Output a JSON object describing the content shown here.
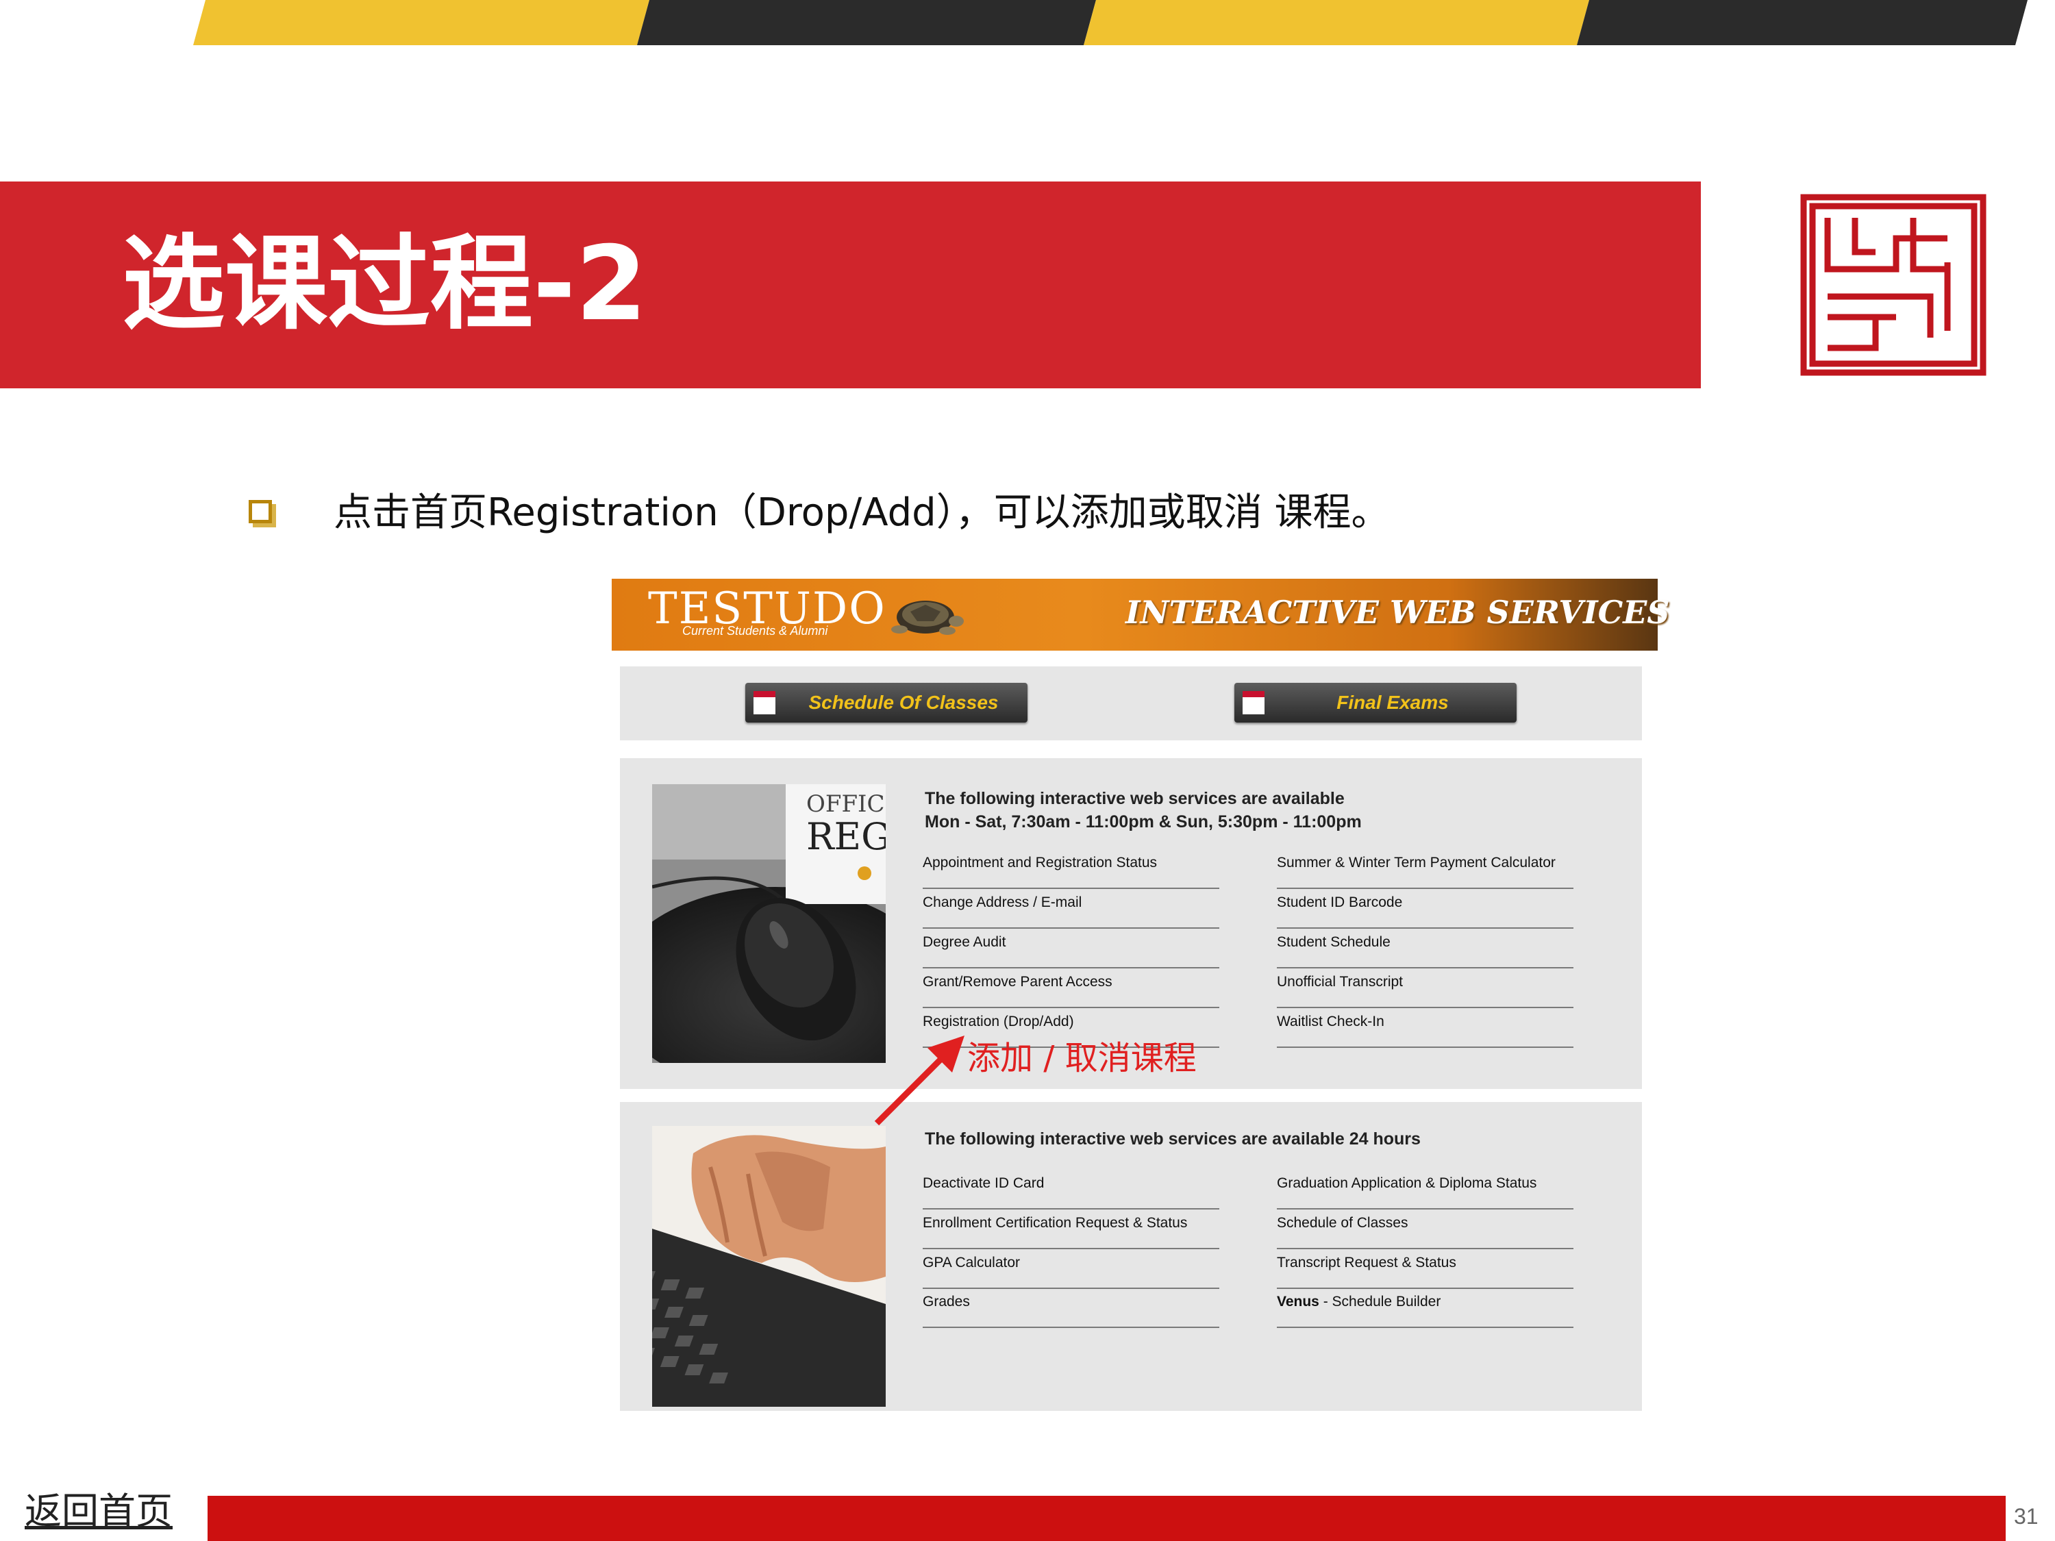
{
  "colors": {
    "banner_red": "#d0252c",
    "stripe_yellow": "#f0c230",
    "stripe_black": "#2b2b2b",
    "footer_red": "#cc1010",
    "annotation_red": "#e02020",
    "testudo_orange": "#e07b12",
    "button_text_yellow": "#f2c21a"
  },
  "slide": {
    "title": "选课过程-2",
    "bullet_text": "点击首页Registration（Drop/Add），可以添加或取消 课程。",
    "home_link": "返回首页",
    "page_number": "31"
  },
  "testudo": {
    "title": "TESTUDO",
    "subtitle": "Current Students & Alumni",
    "services_title": "INTERACTIVE WEB SERVICES",
    "buttons": [
      {
        "label": "Schedule Of Classes",
        "icon": "calendar-icon"
      },
      {
        "label": "Final Exams",
        "icon": "calendar-icon"
      }
    ],
    "section_a": {
      "heading_line1": "The following interactive web services are available",
      "heading_line2": "Mon - Sat, 7:30am - 11:00pm & Sun, 5:30pm - 11:00pm",
      "left_links": [
        "Appointment and Registration Status",
        "Change Address / E-mail",
        "Degree Audit",
        "Grant/Remove Parent Access",
        "Registration (Drop/Add)"
      ],
      "right_links": [
        "Summer & Winter Term Payment Calculator",
        "Student ID Barcode",
        "Student Schedule",
        "Unofficial Transcript",
        "Waitlist Check-In"
      ],
      "photo": "mouse-and-mug-photo",
      "mug_text_1": "OFFIC",
      "mug_text_2": "REG"
    },
    "section_b": {
      "heading": "The following interactive web services are available 24 hours",
      "left_links": [
        "Deactivate ID Card",
        "Enrollment Certification Request & Status",
        "GPA Calculator",
        "Grades"
      ],
      "right_links": [
        "Graduation Application & Diploma Status",
        "Schedule of Classes",
        "Transcript Request & Status"
      ],
      "venus_bold": "Venus",
      "venus_rest": " - Schedule Builder",
      "photo": "hands-typing-keyboard-photo"
    },
    "annotation": "添加 / 取消课程"
  }
}
